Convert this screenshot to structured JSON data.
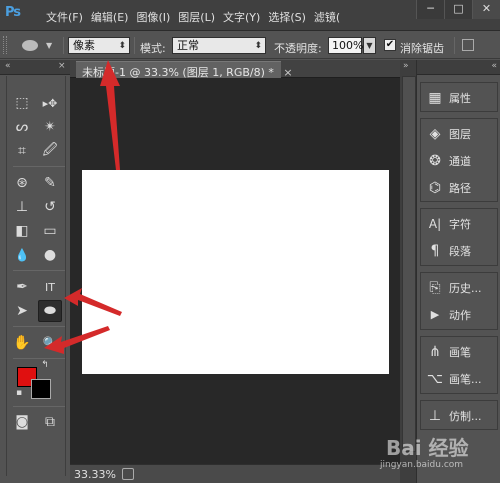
{
  "app": {
    "logo_text": "Ps",
    "menu": [
      "文件(F)",
      "编辑(E)",
      "图像(I)",
      "图层(L)",
      "文字(Y)",
      "选择(S)",
      "滤镜("
    ],
    "window_controls": [
      "─",
      "□",
      "✕"
    ]
  },
  "options_bar": {
    "tool_icon": "ellipse-tool-icon",
    "mode_select": "像素",
    "mode_label": "模式:",
    "blend_select": "正常",
    "opacity_label": "不透明度:",
    "opacity_value": "100%",
    "antialias_checked": true,
    "antialias_label": "消除锯齿"
  },
  "toolbox": {
    "tools": [
      {
        "name": "rectangular-marquee-icon",
        "glyph": "⬚"
      },
      {
        "name": "move-icon",
        "glyph": "▸✥"
      },
      {
        "name": "lasso-icon",
        "glyph": "ᔕ"
      },
      {
        "name": "magic-wand-icon",
        "glyph": "✴"
      },
      {
        "name": "crop-icon",
        "glyph": "⌗"
      },
      {
        "name": "eyedropper-icon",
        "glyph": "🖉"
      },
      {
        "name": "spot-healing-icon",
        "glyph": "⊛"
      },
      {
        "name": "brush-icon",
        "glyph": "✎"
      },
      {
        "name": "clone-stamp-icon",
        "glyph": "⊥"
      },
      {
        "name": "history-brush-icon",
        "glyph": "↺"
      },
      {
        "name": "eraser-icon",
        "glyph": "◧"
      },
      {
        "name": "gradient-icon",
        "glyph": "▭"
      },
      {
        "name": "blur-icon",
        "glyph": "💧"
      },
      {
        "name": "dodge-icon",
        "glyph": "●"
      },
      {
        "name": "pen-icon",
        "glyph": "✒"
      },
      {
        "name": "type-icon",
        "glyph": "IT"
      },
      {
        "name": "path-selection-icon",
        "glyph": "➤"
      },
      {
        "name": "ellipse-icon",
        "glyph": "⬬"
      },
      {
        "name": "hand-icon",
        "glyph": "✋"
      },
      {
        "name": "zoom-icon",
        "glyph": "🔍"
      },
      {
        "name": "quick-mask-icon",
        "glyph": "◙"
      },
      {
        "name": "screen-mode-icon",
        "glyph": "⧉"
      }
    ],
    "foreground_color": "#e01010",
    "background_color": "#000000"
  },
  "document": {
    "tab_title": "未标题-1 @ 33.3% (图层 1, RGB/8) *",
    "tab_close": "×",
    "zoom": "33.33%",
    "canvas_color": "#ffffff",
    "pasteboard_color": "#282828"
  },
  "panels": {
    "group1": [
      {
        "icon": "properties-icon",
        "glyph": "▦",
        "label": "属性"
      }
    ],
    "group2": [
      {
        "icon": "layers-icon",
        "glyph": "◈",
        "label": "图层"
      },
      {
        "icon": "channels-icon",
        "glyph": "❂",
        "label": "通道"
      },
      {
        "icon": "paths-icon",
        "glyph": "⌬",
        "label": "路径"
      }
    ],
    "group3": [
      {
        "icon": "character-icon",
        "glyph": "A|",
        "label": "字符"
      },
      {
        "icon": "paragraph-icon",
        "glyph": "¶",
        "label": "段落"
      }
    ],
    "group4": [
      {
        "icon": "history-icon",
        "glyph": "⎘",
        "label": "历史..."
      },
      {
        "icon": "actions-icon",
        "glyph": "▶",
        "label": "动作"
      }
    ],
    "group5": [
      {
        "icon": "brushes-icon",
        "glyph": "⋔",
        "label": "画笔"
      },
      {
        "icon": "brush-presets-icon",
        "glyph": "⌥",
        "label": "画笔..."
      }
    ],
    "group6": [
      {
        "icon": "clone-source-icon",
        "glyph": "⊥",
        "label": "仿制..."
      }
    ]
  },
  "watermark": {
    "main": "Bai 经验",
    "sub": "jingyan.baidu.com"
  },
  "colors": {
    "annotation": "#d42a2a",
    "ui_dark": "#404040",
    "ui_mid": "#535353"
  }
}
